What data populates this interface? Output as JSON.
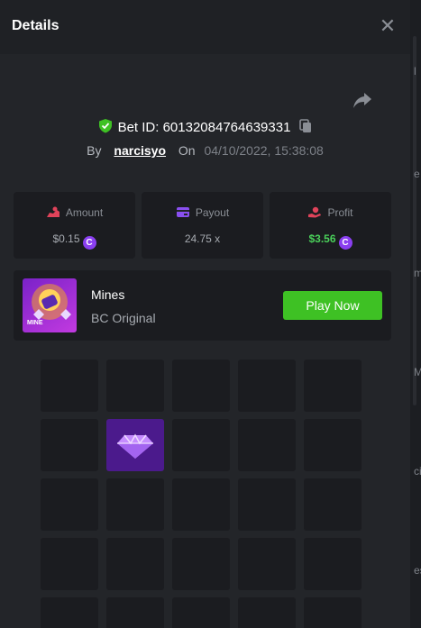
{
  "header": {
    "title": "Details",
    "close_icon": "close-icon"
  },
  "bet": {
    "id_label": "Bet ID:",
    "id_value": "60132084764639331",
    "by_label": "By",
    "username": "narcisyo",
    "on_label": "On",
    "datetime": "04/10/2022, 15:38:08"
  },
  "stats": {
    "amount": {
      "label": "Amount",
      "value": "$0.15"
    },
    "payout": {
      "label": "Payout",
      "value": "24.75 x"
    },
    "profit": {
      "label": "Profit",
      "value": "$3.56"
    },
    "coin_symbol": "C"
  },
  "game": {
    "name": "Mines",
    "provider": "BC Original",
    "thumb_label": "MINE",
    "play_label": "Play Now"
  },
  "mines_grid": {
    "rows_visible": 5,
    "cols": 5,
    "revealed": [
      {
        "row": 2,
        "col": 2,
        "type": "gem"
      }
    ]
  },
  "side_fragments": [
    "l",
    "e",
    "m",
    "M",
    "ci",
    "es"
  ],
  "colors": {
    "accent_green": "#3ec124",
    "profit_green": "#4ad15a",
    "gem_purple": "#4b1a8c",
    "coin": "#8a3ff0"
  }
}
